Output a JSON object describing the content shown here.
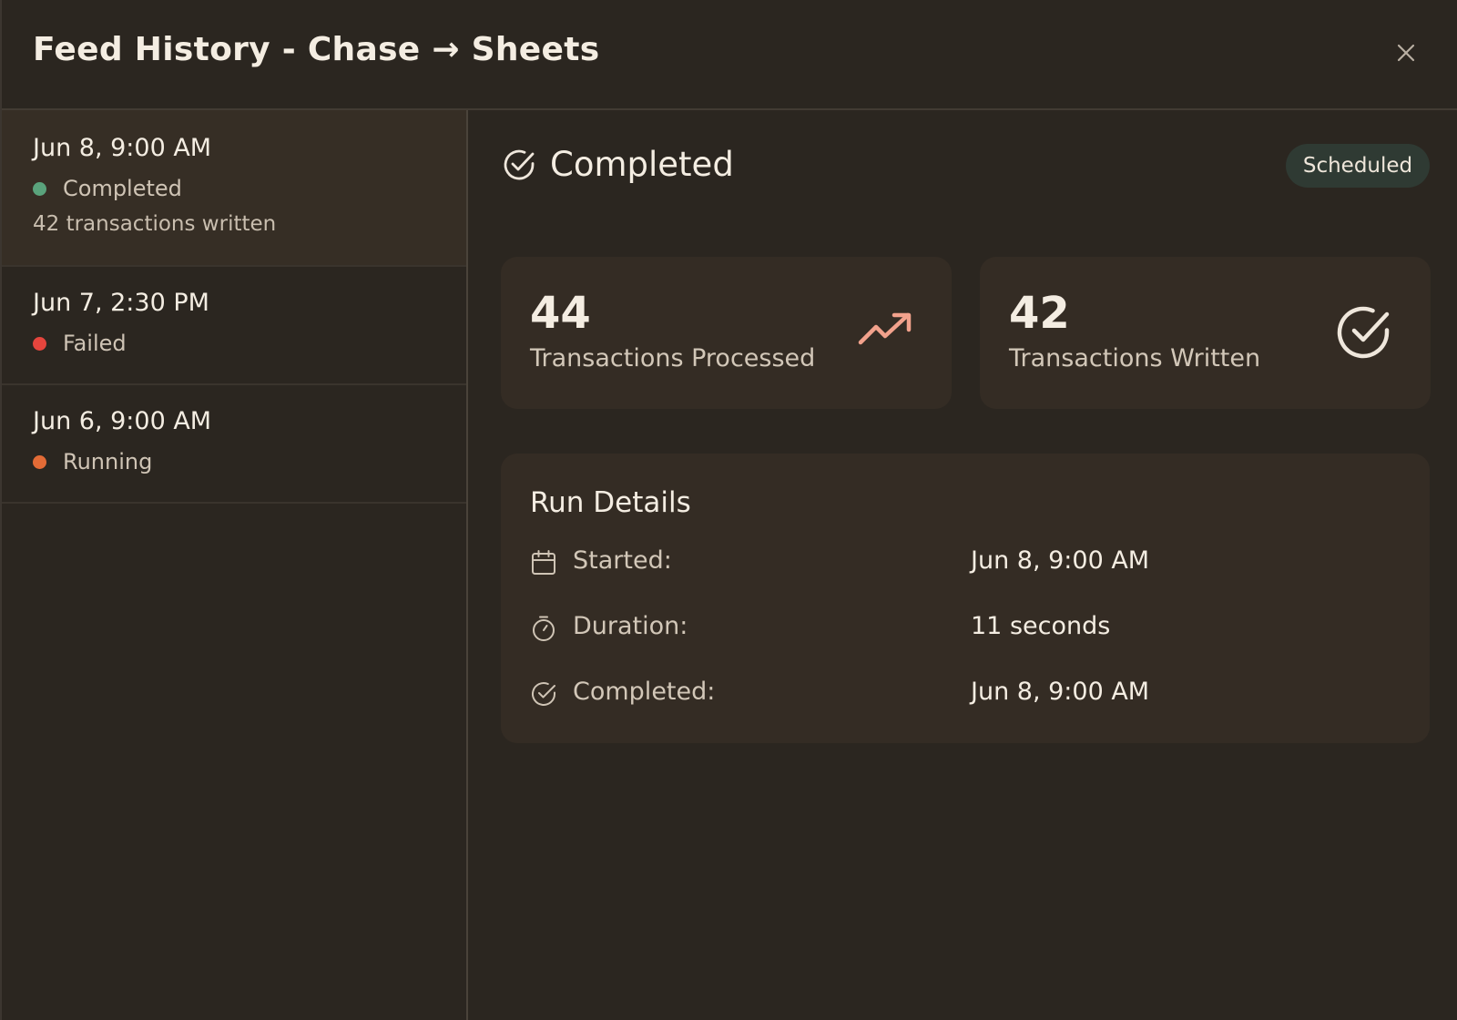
{
  "header": {
    "title": "Feed History - Chase → Sheets",
    "close_icon": "close-icon"
  },
  "runs": [
    {
      "date": "Jun 8, 9:00 AM",
      "status": "Completed",
      "status_color": "#5aa37c",
      "summary": "42 transactions written",
      "selected": true
    },
    {
      "date": "Jun 7, 2:30 PM",
      "status": "Failed",
      "status_color": "#e5453d",
      "selected": false
    },
    {
      "date": "Jun 6, 9:00 AM",
      "status": "Running",
      "status_color": "#e36b36",
      "selected": false
    }
  ],
  "detail": {
    "status": "Completed",
    "status_icon": "check-circle-icon",
    "badge": "Scheduled",
    "stats": [
      {
        "value": "44",
        "label": "Transactions Processed",
        "icon": "trending-up-icon",
        "icon_color": "#f2a28c"
      },
      {
        "value": "42",
        "label": "Transactions Written",
        "icon": "check-circle-icon",
        "icon_color": "#efe7dc"
      }
    ],
    "run_details": {
      "title": "Run Details",
      "rows": [
        {
          "icon": "calendar-icon",
          "label": "Started:",
          "value": "Jun 8, 9:00 AM"
        },
        {
          "icon": "stopwatch-icon",
          "label": "Duration:",
          "value": "11 seconds"
        },
        {
          "icon": "check-circle-icon",
          "label": "Completed:",
          "value": "Jun 8, 9:00 AM"
        }
      ]
    }
  }
}
